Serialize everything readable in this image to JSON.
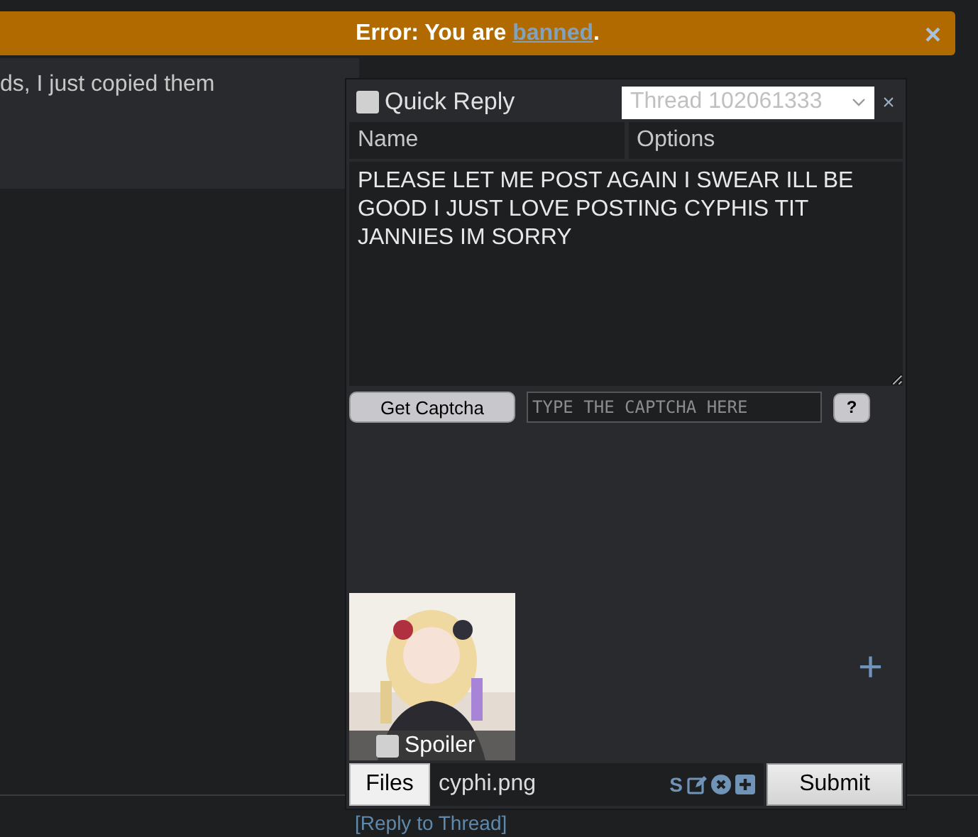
{
  "banner": {
    "prefix": "Error: You are ",
    "link": "banned",
    "suffix": ".",
    "close": "×"
  },
  "post": {
    "text": "ds, I just copied them"
  },
  "reply_link": "[Reply to Thread]",
  "quick_reply": {
    "title": "Quick Reply",
    "checked": false,
    "thread_placeholder": "Thread 102061333",
    "close": "×",
    "name_placeholder": "Name",
    "options_placeholder": "Options",
    "comment": "PLEASE LET ME POST AGAIN I SWEAR ILL BE GOOD I JUST LOVE POSTING CYPHIS TIT JANNIES IM SORRY",
    "captcha_button": "Get Captcha",
    "captcha_placeholder": "TYPE THE CAPTCHA HERE",
    "help": "?",
    "attachment": {
      "kind": "picture",
      "spoiler_label": "Spoiler",
      "spoiler": false
    },
    "add": "+",
    "files_button": "Files",
    "filename": "cyphi.png",
    "spoiler_toggle": "S",
    "submit": "Submit"
  }
}
